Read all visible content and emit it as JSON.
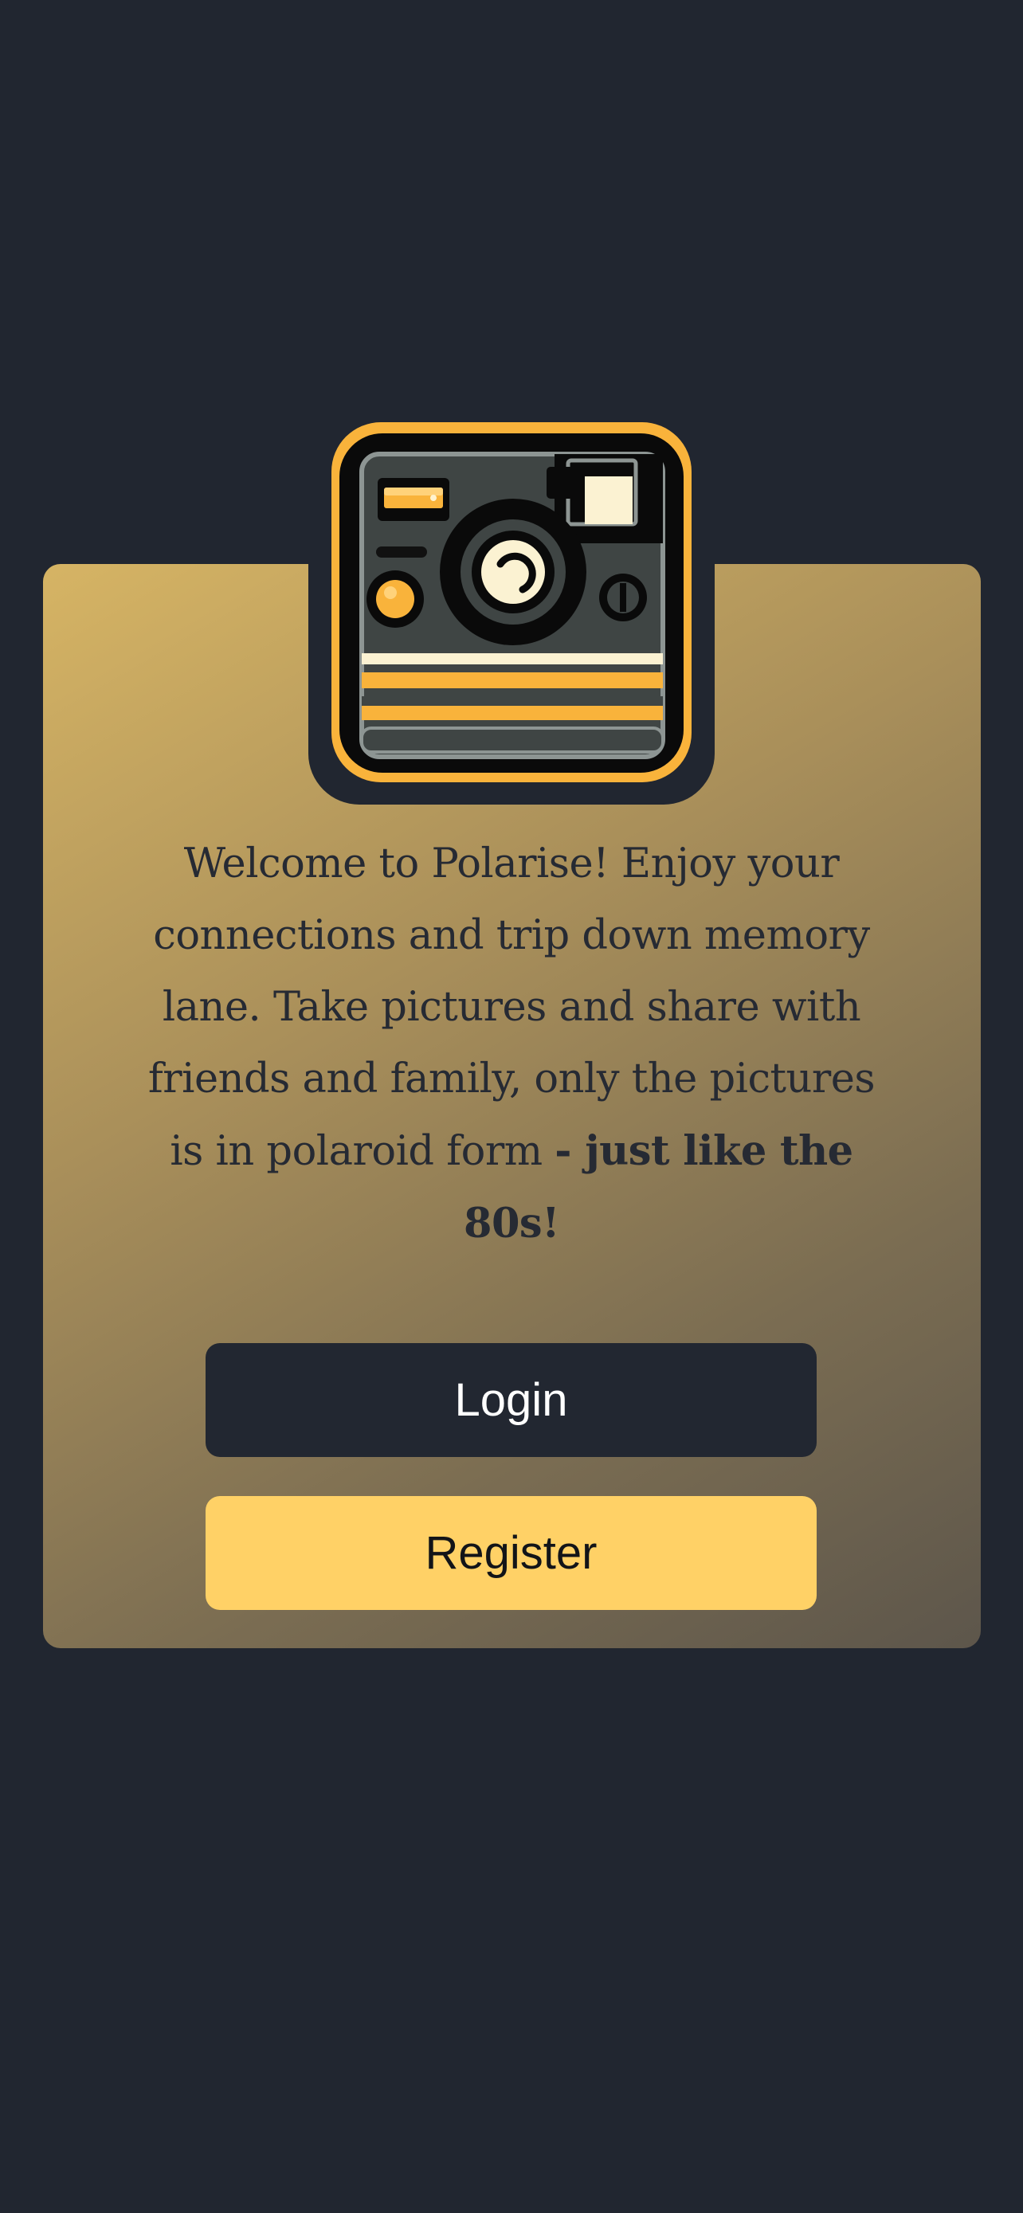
{
  "welcome": {
    "text": "Welcome to Polarise! Enjoy your connections and trip down memory lane. Take pictures and share with friends and family, only the pictures is in polaroid form ",
    "emphasis": "- just like the 80s!"
  },
  "buttons": {
    "login_label": "Login",
    "register_label": "Register"
  },
  "icons": {
    "logo": "polaroid-camera-icon"
  },
  "colors": {
    "background": "#212630",
    "card_gradient_start": "#d6b464",
    "card_gradient_end": "#5d564b",
    "login_button": "#222731",
    "register_button": "#ffd166",
    "logo_accent": "#f9b33b"
  }
}
